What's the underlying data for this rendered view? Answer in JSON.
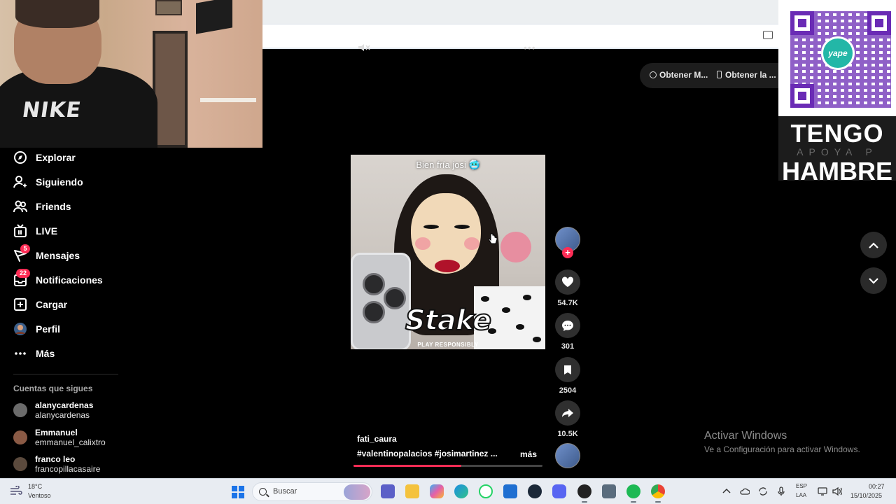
{
  "browser": {
    "icons": [
      "cast-icon",
      "mute-icon",
      "more-options-icon"
    ]
  },
  "webcam": {
    "shirt_logo": "NIKE"
  },
  "donation_panel": {
    "brand_logo": "yape",
    "title_line1": "TENGO",
    "subtitle": "APOYA P",
    "title_line2": "HAMBRE",
    "accent": "#6a2bb5"
  },
  "header_buttons": [
    {
      "label": "Obtener M...",
      "icon": "coin-icon"
    },
    {
      "label": "Obtener la ...",
      "icon": "phone-icon"
    }
  ],
  "sidebar": {
    "items": [
      {
        "label": "Explorar",
        "icon": "compass-icon"
      },
      {
        "label": "Siguiendo",
        "icon": "person-follow-icon"
      },
      {
        "label": "Friends",
        "icon": "friends-icon"
      },
      {
        "label": "LIVE",
        "icon": "live-tv-icon"
      },
      {
        "label": "Mensajes",
        "icon": "message-icon",
        "badge": "5"
      },
      {
        "label": "Notificaciones",
        "icon": "inbox-icon",
        "badge": "22"
      },
      {
        "label": "Cargar",
        "icon": "upload-plus-icon"
      },
      {
        "label": "Perfil",
        "icon": "profile-avatar-icon"
      },
      {
        "label": "Más",
        "icon": "more-dots-icon"
      }
    ],
    "following_title": "Cuentas que sigues",
    "following": [
      {
        "name": "alanycardenas",
        "username": "alanycardenas"
      },
      {
        "name": "Emmanuel",
        "username": "emmanuel_calixtro"
      },
      {
        "name": "franco leo",
        "username": "francopillacasaire"
      }
    ]
  },
  "video": {
    "caption": "Bien fría josi 🥶",
    "overlay_brand": "Stake",
    "overlay_small": "PLAY RESPONSIBLY",
    "author": "fati_caura",
    "tags": "#valentinopalacios  #josimartinez  ...",
    "more": "más",
    "progress": 0.57
  },
  "actions": {
    "likes": "54.7K",
    "comments": "301",
    "saves": "2504",
    "shares": "10.5K",
    "follow_plus": "+"
  },
  "watermark": {
    "line1": "Activar Windows",
    "line2": "Ve a Configuración para activar Windows."
  },
  "taskbar": {
    "temp": "18°C",
    "weather": "Ventoso",
    "search_placeholder": "Buscar",
    "apps": [
      "teams-icon",
      "file-explorer-icon",
      "copilot-icon",
      "edge-icon",
      "whatsapp-icon",
      "store-icon",
      "steam-icon",
      "discord-icon",
      "obs-icon",
      "calculator-icon",
      "spotify-icon",
      "chrome-icon"
    ],
    "lang1": "ESP",
    "lang2": "LAA",
    "time": "00:27",
    "date": "15/10/2025"
  },
  "colors": {
    "brand_red": "#fe2c55",
    "background": "#000000",
    "taskbar": "#e8ecf2"
  }
}
